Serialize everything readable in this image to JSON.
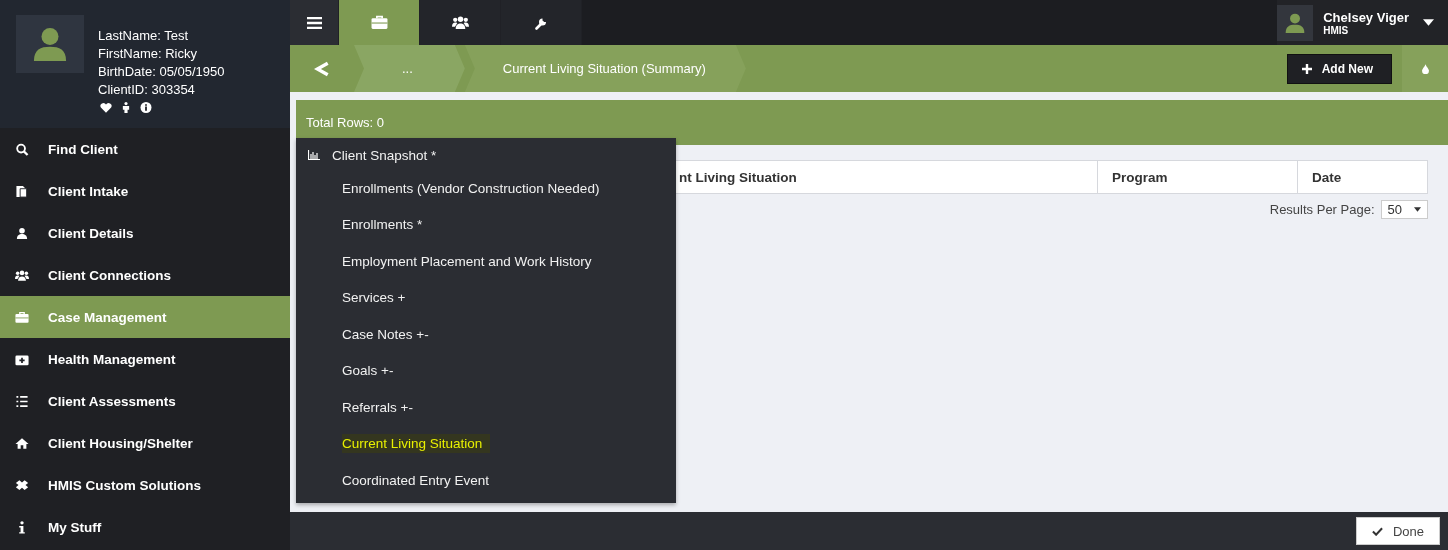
{
  "client": {
    "lines": [
      "LastName: Test",
      "FirstName: Ricky",
      "BirthDate: 05/05/1950",
      "ClientID: 303354"
    ]
  },
  "sidebar": {
    "items": [
      {
        "label": "Find Client",
        "selected": false
      },
      {
        "label": "Client Intake",
        "selected": false
      },
      {
        "label": "Client Details",
        "selected": false
      },
      {
        "label": "Client Connections",
        "selected": false
      },
      {
        "label": "Case Management",
        "selected": true
      },
      {
        "label": "Health Management",
        "selected": false
      },
      {
        "label": "Client Assessments",
        "selected": false
      },
      {
        "label": "Client Housing/Shelter",
        "selected": false
      },
      {
        "label": "HMIS Custom Solutions",
        "selected": false
      },
      {
        "label": "My Stuff",
        "selected": false
      }
    ]
  },
  "top_tabs": [
    {
      "selected": false
    },
    {
      "selected": true
    },
    {
      "selected": false
    },
    {
      "selected": false
    }
  ],
  "user": {
    "name": "Chelsey Viger",
    "role": "HMIS"
  },
  "breadcrumb": [
    "...",
    "Current Living Situation (Summary)"
  ],
  "add_button": "Add New",
  "total_rows": "Total Rows: 0",
  "table": {
    "columns": [
      "nt Living Situation",
      "Program",
      "Date"
    ]
  },
  "results_per_page": {
    "label": "Results Per Page:",
    "value": "50"
  },
  "dropdown": {
    "items": [
      {
        "label": "Client Snapshot *",
        "kind": "chart",
        "selected": false
      },
      {
        "label": "Enrollments (Vendor Construction Needed)",
        "kind": "plain",
        "selected": false
      },
      {
        "label": "Enrollments *",
        "kind": "plain",
        "selected": false
      },
      {
        "label": "Employment Placement and Work History",
        "kind": "plain",
        "selected": false
      },
      {
        "label": "Services +",
        "kind": "plain",
        "selected": false
      },
      {
        "label": "Case Notes +-",
        "kind": "plain",
        "selected": false
      },
      {
        "label": "Goals +-",
        "kind": "plain",
        "selected": false
      },
      {
        "label": "Referrals +-",
        "kind": "plain",
        "selected": false
      },
      {
        "label": "Current Living Situation",
        "kind": "plain",
        "selected": true
      },
      {
        "label": "Coordinated Entry Event",
        "kind": "plain",
        "selected": false
      }
    ]
  },
  "done_button": "Done"
}
